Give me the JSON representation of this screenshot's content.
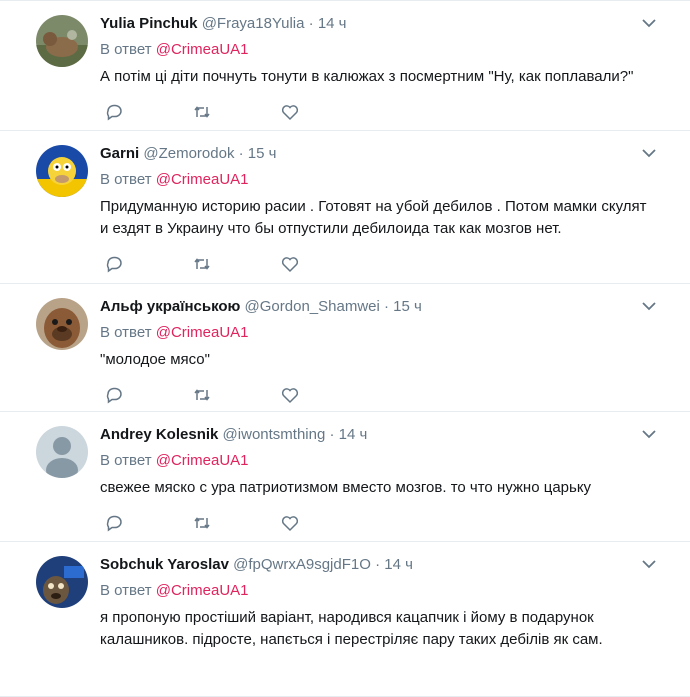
{
  "tweets": [
    {
      "name": "Yulia Pinchuk",
      "handle": "@Fraya18Yulia",
      "time": "14 ч",
      "reply_prefix": "В ответ",
      "reply_to": "@CrimeaUA1",
      "text": "А потім ці діти почнуть тонути в калюжах з посмертним \"Ну, как поплавали?\""
    },
    {
      "name": "Garni",
      "handle": "@Zemorodok",
      "time": "15 ч",
      "reply_prefix": "В ответ",
      "reply_to": "@CrimeaUA1",
      "text": "Придуманную историю расии . Готовят на убой дебилов . Потом мамки скулят и ездят в Украину что бы отпустили дебилоида так как мозгов нет."
    },
    {
      "name": "Альф українською",
      "handle": "@Gordon_Shamwei",
      "time": "15 ч",
      "reply_prefix": "В ответ",
      "reply_to": "@CrimeaUA1",
      "text": "\"молодое мясо\""
    },
    {
      "name": "Andrey Kolesnik",
      "handle": "@iwontsmthing",
      "time": "14 ч",
      "reply_prefix": "В ответ",
      "reply_to": "@CrimeaUA1",
      "text": "свежее мяско с ура патриотизмом вместо мозгов. то что нужно царьку"
    },
    {
      "name": "Sobchuk Yaroslav",
      "handle": "@fpQwrxA9sgjdF1O",
      "time": "14 ч",
      "reply_prefix": "В ответ",
      "reply_to": "@CrimeaUA1",
      "text": "я пропоную простіший варіант, народився кацапчик і йому в подарунок калашников. підросте, напється і перестріляє пару таких дебілів як сам."
    }
  ],
  "colors": {
    "accent": "#e0245e",
    "muted": "#657786",
    "text": "#14171a",
    "border": "#e6ecf0"
  },
  "icons": [
    "reply-icon",
    "retweet-icon",
    "like-icon",
    "chevron-down-icon"
  ]
}
